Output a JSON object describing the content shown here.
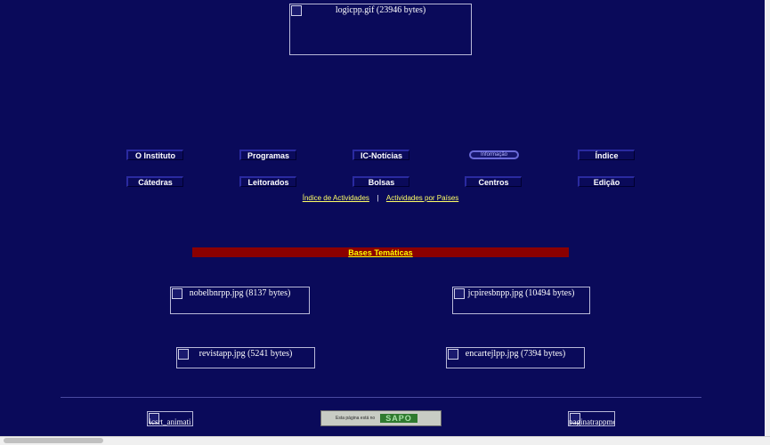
{
  "header": {
    "logo_alt": "logicpp.gif (23946 bytes)"
  },
  "nav": {
    "row1": [
      "O Instituto",
      "Programas",
      "IC-Notícias",
      "Informação",
      "Índice"
    ],
    "row2": [
      "Cátedras",
      "Leitorados",
      "Bolsas",
      "Centros",
      "Edição"
    ]
  },
  "links": {
    "activities_index": "Índice de Actividades",
    "separator": "|",
    "activities_by_country": "Actividades por Países"
  },
  "bases": {
    "label": "Bases Temáticas"
  },
  "images": {
    "nobel": "nobelbnrpp.jpg (8137 bytes)",
    "jcpires": "jcpiresbnpp.jpg (10494 bytes)",
    "revista": "revistapp.jpg (5241 bytes)",
    "encarte": "encartejlpp.jpg (7394 bytes)"
  },
  "footer": {
    "left_alt": "icsrt_animati",
    "sapo_text": "Esta página está no",
    "sapo_brand": "SAPO",
    "right_alt": "paginatrappmd"
  }
}
